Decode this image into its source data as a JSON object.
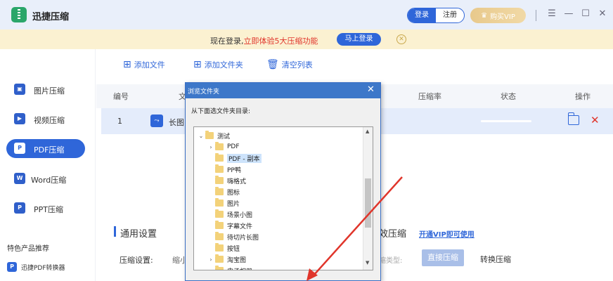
{
  "window": {
    "title": "迅捷压缩",
    "login": "登录",
    "register": "注册",
    "vip": "购买VIP",
    "vip_icon": "crown-icon"
  },
  "promo": {
    "text_prefix": "现在登录,",
    "text_highlight": "立即体验5大压缩功能",
    "button": "马上登录"
  },
  "sidebar": {
    "items": [
      {
        "label": "图片压缩",
        "icon": "image-compress-icon"
      },
      {
        "label": "视频压缩",
        "icon": "video-compress-icon"
      },
      {
        "label": "PDF压缩",
        "icon": "pdf-compress-icon",
        "active": true
      },
      {
        "label": "Word压缩",
        "icon": "word-compress-icon"
      },
      {
        "label": "PPT压缩",
        "icon": "ppt-compress-icon"
      }
    ],
    "featured_title": "特色产品推荐",
    "featured_item": "迅捷PDF转换器"
  },
  "toolbar": {
    "add_file": "添加文件",
    "add_folder": "添加文件夹",
    "clear_list": "清空列表"
  },
  "table": {
    "headers": {
      "num": "编号",
      "name": "文",
      "ratio": "压缩率",
      "status": "状态",
      "action": "操作"
    },
    "rows": [
      {
        "num": "1",
        "name": "长图"
      }
    ]
  },
  "settings": {
    "general_title": "通用设置",
    "compress_label": "压缩设置:",
    "compress_value": "缩小",
    "efficient_title": "效压缩",
    "open_vip": "开通VIP即可使用",
    "compress_type_label": "缩类型:",
    "direct_compress": "直接压缩",
    "convert_compress": "转换压缩"
  },
  "dialog": {
    "title": "浏览文件夹",
    "prompt": "从下面选文件夹目录:",
    "tree": [
      {
        "name": "测试",
        "level": 0,
        "arrow": "expanded"
      },
      {
        "name": "PDF",
        "level": 1,
        "arrow": "collapsed"
      },
      {
        "name": "PDF - 副本",
        "level": 1,
        "arrow": "none",
        "selected": true
      },
      {
        "name": "PP鸭",
        "level": 1,
        "arrow": "none"
      },
      {
        "name": "嗨格式",
        "level": 1,
        "arrow": "none"
      },
      {
        "name": "图标",
        "level": 1,
        "arrow": "none"
      },
      {
        "name": "图片",
        "level": 1,
        "arrow": "none"
      },
      {
        "name": "场景小图",
        "level": 1,
        "arrow": "none"
      },
      {
        "name": "字幕文件",
        "level": 1,
        "arrow": "none"
      },
      {
        "name": "待切片长图",
        "level": 1,
        "arrow": "none"
      },
      {
        "name": "按钮",
        "level": 1,
        "arrow": "none"
      },
      {
        "name": "淘宝图",
        "level": 1,
        "arrow": "collapsed"
      },
      {
        "name": "电子相册",
        "level": 1,
        "arrow": "none"
      }
    ]
  },
  "colors": {
    "accent": "#2f66d9",
    "danger": "#e0352b",
    "annotation": "#e0352b"
  }
}
